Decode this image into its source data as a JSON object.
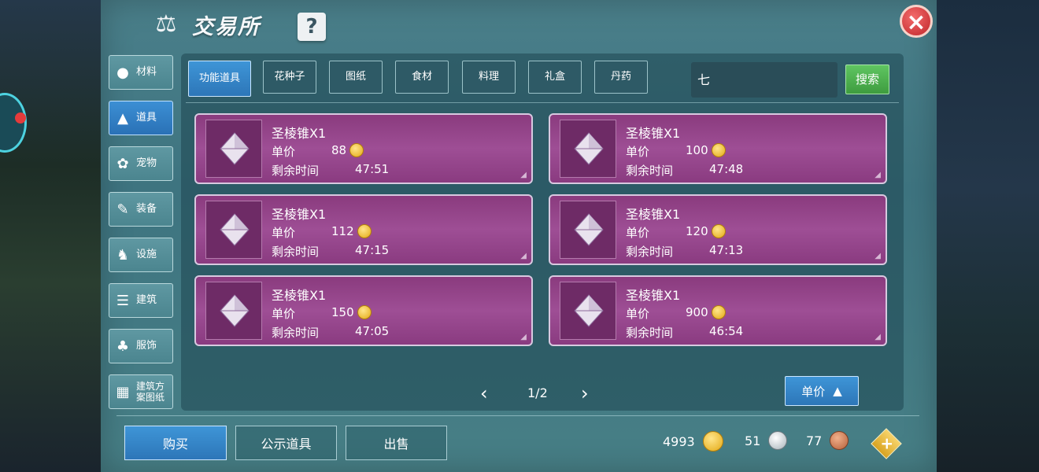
{
  "header": {
    "title": "交易所",
    "help": "?",
    "close": "×"
  },
  "sidebar": {
    "items": [
      {
        "label": "材料",
        "icon": "materials-icon"
      },
      {
        "label": "道具",
        "icon": "item-icon",
        "active": true
      },
      {
        "label": "宠物",
        "icon": "paw-icon"
      },
      {
        "label": "装备",
        "icon": "equipment-icon"
      },
      {
        "label": "设施",
        "icon": "facility-icon"
      },
      {
        "label": "建筑",
        "icon": "building-icon"
      },
      {
        "label": "服饰",
        "icon": "clothing-icon"
      },
      {
        "label": "建筑方案图纸",
        "icon": "blueprint-icon"
      }
    ]
  },
  "tabs": [
    {
      "label": "功能道具",
      "active": true
    },
    {
      "label": "花种子"
    },
    {
      "label": "图纸"
    },
    {
      "label": "食材"
    },
    {
      "label": "料理"
    },
    {
      "label": "礼盒"
    },
    {
      "label": "丹药"
    }
  ],
  "search": {
    "value": "七",
    "button": "搜索"
  },
  "listings": [
    {
      "name": "圣棱锥X1",
      "price_label": "单价",
      "price": "88",
      "time_label": "剩余时间",
      "time": "47:51"
    },
    {
      "name": "圣棱锥X1",
      "price_label": "单价",
      "price": "100",
      "time_label": "剩余时间",
      "time": "47:48"
    },
    {
      "name": "圣棱锥X1",
      "price_label": "单价",
      "price": "112",
      "time_label": "剩余时间",
      "time": "47:15"
    },
    {
      "name": "圣棱锥X1",
      "price_label": "单价",
      "price": "120",
      "time_label": "剩余时间",
      "time": "47:13"
    },
    {
      "name": "圣棱锥X1",
      "price_label": "单价",
      "price": "150",
      "time_label": "剩余时间",
      "time": "47:05"
    },
    {
      "name": "圣棱锥X1",
      "price_label": "单价",
      "price": "900",
      "time_label": "剩余时间",
      "time": "46:54"
    }
  ],
  "pager": {
    "current": "1/2",
    "prev": "‹",
    "next": "›"
  },
  "sort": {
    "label": "单价"
  },
  "bottom": {
    "buy": "购买",
    "display": "公示道具",
    "sell": "出售"
  },
  "currency": {
    "gold": "4993",
    "silver": "51",
    "bronze": "77",
    "add": "+"
  },
  "colors": {
    "accent_blue": "#2d76b8",
    "card_purple": "#9e4e95",
    "panel_teal": "#447a85",
    "search_green": "#4caf50",
    "close_red": "#c0262a"
  }
}
